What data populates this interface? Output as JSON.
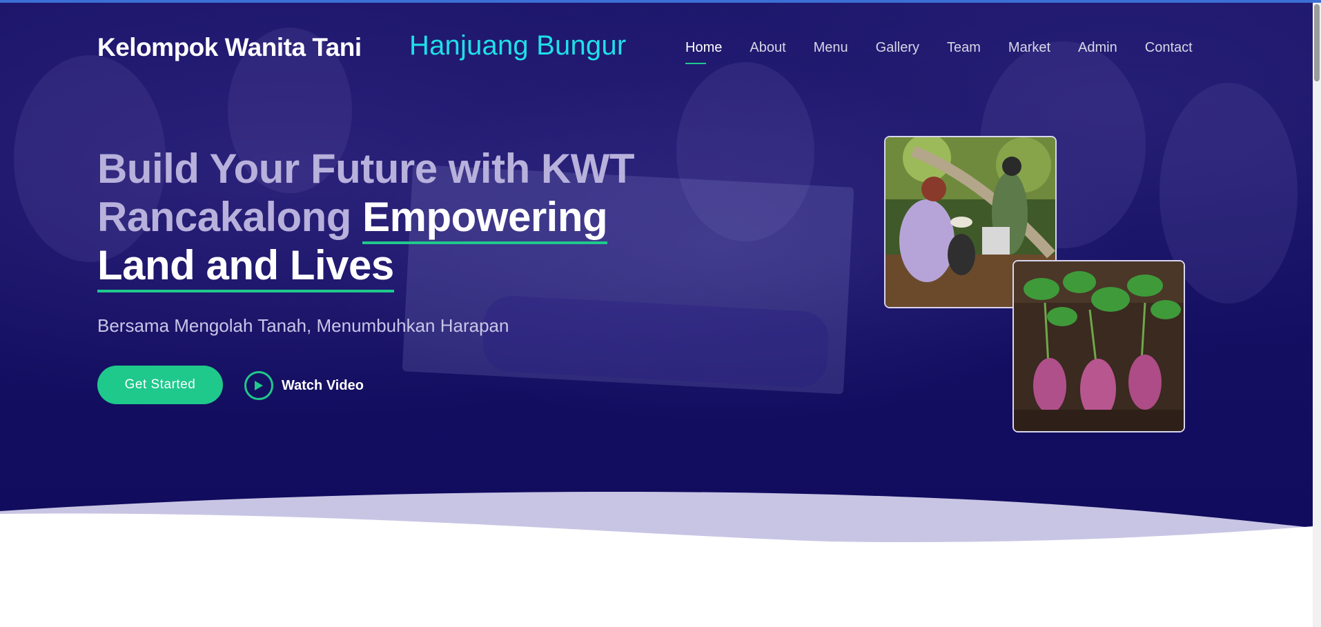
{
  "header": {
    "brand": "Kelompok Wanita Tani",
    "brand_sub": "Hanjuang Bungur"
  },
  "nav": {
    "items": [
      "Home",
      "About",
      "Menu",
      "Gallery",
      "Team",
      "Market",
      "Admin",
      "Contact"
    ],
    "active": "Home"
  },
  "hero": {
    "headline_part1": "Build Your Future with KWT Rancakalong ",
    "headline_highlight1": "Empowering",
    "headline_space": " ",
    "headline_highlight2": "Land and Lives",
    "tagline": "Bersama Mengolah Tanah, Menumbuhkan Harapan",
    "cta_primary": "Get Started",
    "cta_video": "Watch Video"
  },
  "colors": {
    "hero_bg": "#140f62",
    "accent": "#1fc98b",
    "brand_sub": "#1fe0e8"
  },
  "icons": {
    "play": "play-icon"
  }
}
